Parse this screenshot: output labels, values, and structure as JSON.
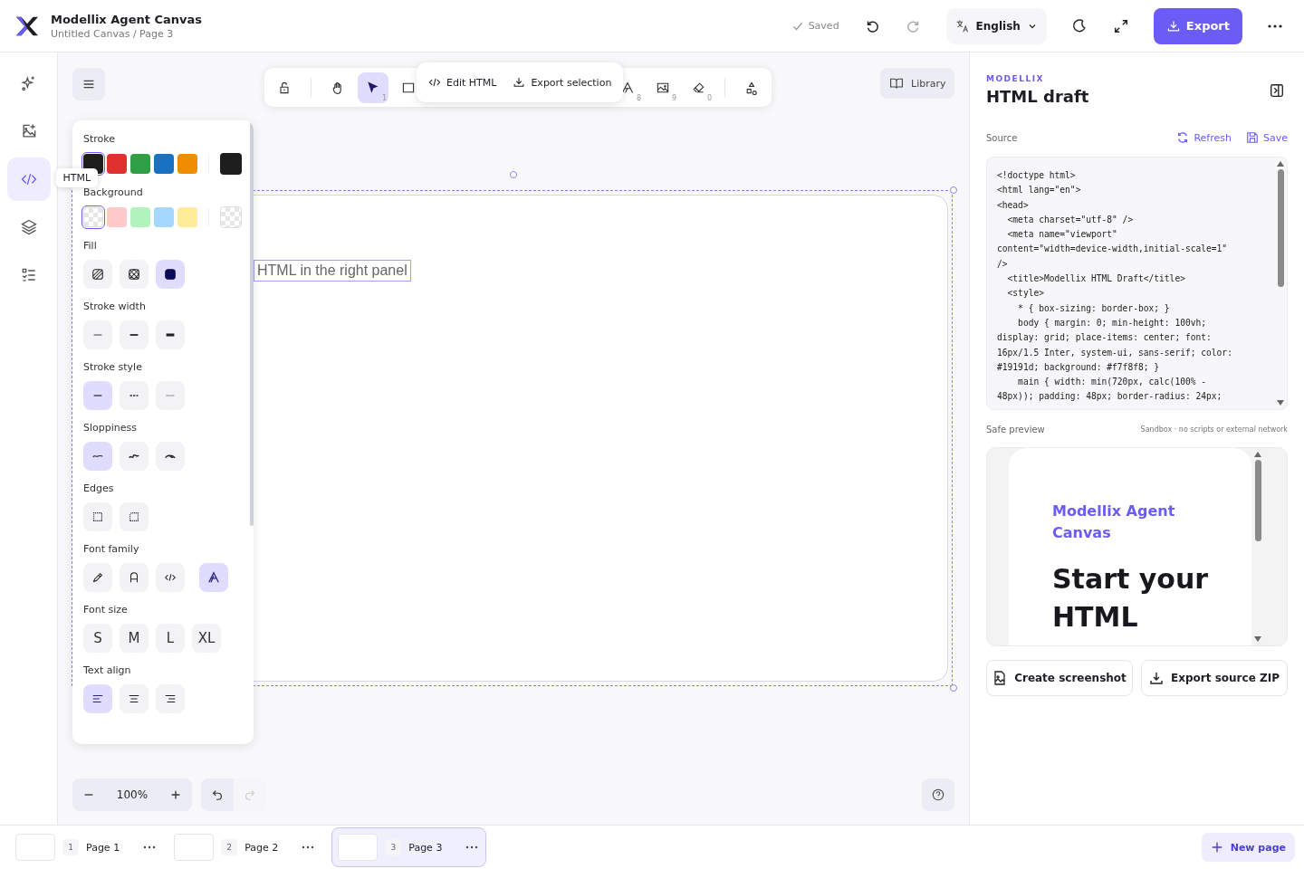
{
  "app": {
    "title": "Modellix Agent Canvas",
    "subtitle": "Untitled Canvas / Page 3"
  },
  "header": {
    "status": "Saved",
    "language": "English",
    "export": "Export"
  },
  "rail": [
    {
      "kind": "sparkle",
      "selected": false
    },
    {
      "kind": "image-add",
      "selected": false
    },
    {
      "kind": "code",
      "selected": true,
      "tooltip": "HTML"
    },
    {
      "kind": "layers",
      "selected": false
    },
    {
      "kind": "checklist",
      "selected": false
    }
  ],
  "toolbar": {
    "tools": [
      {
        "kind": "lock",
        "selected": false
      },
      {
        "kind": "hand",
        "selected": false
      },
      {
        "kind": "select",
        "selected": true,
        "shortcut": "1"
      },
      {
        "kind": "rectangle",
        "selected": false
      },
      {
        "kind": "text",
        "selected": false,
        "shortcut": "8"
      },
      {
        "kind": "image",
        "selected": false,
        "shortcut": "9"
      },
      {
        "kind": "eraser",
        "selected": false,
        "shortcut": "0"
      },
      {
        "kind": "shapes",
        "selected": false
      }
    ],
    "popover": [
      "Edit HTML",
      "Export selection"
    ]
  },
  "library": "Library",
  "properties": [
    {
      "label": "Stroke",
      "kind": "swatches",
      "swatches": [
        {
          "color": "#1e1e1e",
          "selected": true
        },
        {
          "color": "#e03131",
          "selected": false
        },
        {
          "color": "#2f9e44",
          "selected": false
        },
        {
          "color": "#1971c2",
          "selected": false
        },
        {
          "color": "#f08c00",
          "selected": false
        }
      ],
      "current": {
        "color": "#1e1e1e"
      }
    },
    {
      "label": "Background",
      "kind": "swatches",
      "swatches": [
        {
          "transparent": true,
          "selected": true
        },
        {
          "color": "#ffc9c9",
          "selected": false
        },
        {
          "color": "#b2f2bb",
          "selected": false
        },
        {
          "color": "#a5d8ff",
          "selected": false
        },
        {
          "color": "#ffec99",
          "selected": false
        }
      ],
      "current": {
        "transparent": true
      }
    },
    {
      "label": "Fill",
      "kind": "options",
      "options": [
        {
          "kind": "hachure",
          "selected": false
        },
        {
          "kind": "cross-hatch",
          "selected": false
        },
        {
          "kind": "solid",
          "selected": true
        }
      ]
    },
    {
      "label": "Stroke width",
      "kind": "options",
      "options": [
        {
          "kind": "thin",
          "selected": false
        },
        {
          "kind": "bold",
          "selected": false
        },
        {
          "kind": "extra-bold",
          "selected": false
        }
      ]
    },
    {
      "label": "Stroke style",
      "kind": "options",
      "options": [
        {
          "kind": "solid-line",
          "selected": true
        },
        {
          "kind": "dashed",
          "selected": false
        },
        {
          "kind": "dotted",
          "selected": false
        }
      ]
    },
    {
      "label": "Sloppiness",
      "kind": "options",
      "options": [
        {
          "kind": "architect",
          "selected": true
        },
        {
          "kind": "artist",
          "selected": false
        },
        {
          "kind": "cartoonist",
          "selected": false
        }
      ]
    },
    {
      "label": "Edges",
      "kind": "options",
      "options": [
        {
          "kind": "sharp",
          "selected": false
        },
        {
          "kind": "round",
          "selected": false
        }
      ]
    },
    {
      "label": "Font family",
      "kind": "options",
      "options": [
        {
          "kind": "hand-drawn",
          "selected": false
        },
        {
          "kind": "normal",
          "selected": false
        },
        {
          "kind": "code",
          "selected": false
        },
        {
          "kind": "outline",
          "selected": true
        }
      ]
    },
    {
      "label": "Font size",
      "kind": "options",
      "options": [
        {
          "kind": "text",
          "text": "S",
          "selected": false
        },
        {
          "kind": "text",
          "text": "M",
          "selected": false
        },
        {
          "kind": "text",
          "text": "L",
          "selected": false
        },
        {
          "kind": "text",
          "text": "XL",
          "selected": false
        }
      ]
    },
    {
      "label": "Text align",
      "kind": "options",
      "options": [
        {
          "kind": "align-left",
          "selected": true
        },
        {
          "kind": "align-center",
          "selected": false
        },
        {
          "kind": "align-right",
          "selected": false
        }
      ]
    }
  ],
  "canvas": {
    "text": "HTML in the right panel",
    "zoom": "100%"
  },
  "panel": {
    "eyebrow": "MODELLIX",
    "title": "HTML draft",
    "source_label": "Source",
    "refresh": "Refresh",
    "save": "Save",
    "source_lines": [
      "<!doctype html>",
      "<html lang=\"en\">",
      "<head>",
      "  <meta charset=\"utf-8\" />",
      "  <meta name=\"viewport\"",
      "content=\"width=device-width,initial-scale=1\"",
      "/>",
      "  <title>Modellix HTML Draft</title>",
      "  <style>",
      "    * { box-sizing: border-box; }",
      "    body { margin: 0; min-height: 100vh;",
      "display: grid; place-items: center; font:",
      "16px/1.5 Inter, system-ui, sans-serif; color:",
      "#19191d; background: #f7f8f8; }",
      "    main { width: min(720px, calc(100% -",
      "48px)); padding: 48px; border-radius: 24px;"
    ],
    "preview_label": "Safe preview",
    "preview_note": "Sandbox · no scripts or external network",
    "preview_eyebrow": "Modellix Agent Canvas",
    "preview_heading": "Start your HTML",
    "actions": [
      "Create screenshot",
      "Export source ZIP"
    ]
  },
  "pages": [
    {
      "number": "1",
      "name": "Page 1",
      "selected": false
    },
    {
      "number": "2",
      "name": "Page 2",
      "selected": false
    },
    {
      "number": "3",
      "name": "Page 3",
      "selected": true
    }
  ],
  "new_page": "New page"
}
